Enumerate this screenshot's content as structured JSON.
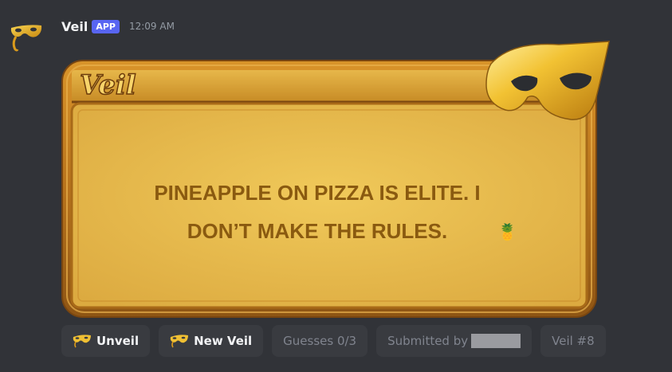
{
  "message": {
    "username": "Veil",
    "badge": "APP",
    "timestamp": "12:09 AM"
  },
  "card": {
    "logo_text": "Veil",
    "line1": "PINEAPPLE ON PIZZA IS ELITE. I",
    "line2": "DON’T MAKE THE RULES.",
    "emoji": "🍍"
  },
  "buttons": {
    "unveil": "Unveil",
    "new_veil": "New Veil",
    "guesses": "Guesses 0/3",
    "submitted_by": "Submitted by",
    "veil_number": "Veil #8"
  },
  "colors": {
    "background": "#313338",
    "badge": "#5865f2",
    "card_gold": "#e6b94e",
    "card_frame": "#b8731c",
    "card_text": "#8a5a10"
  },
  "icons": {
    "avatar": "golden-mask-icon",
    "card_mask": "golden-mask-icon",
    "unveil_button": "mask-icon",
    "new_veil_button": "mask-icon"
  }
}
